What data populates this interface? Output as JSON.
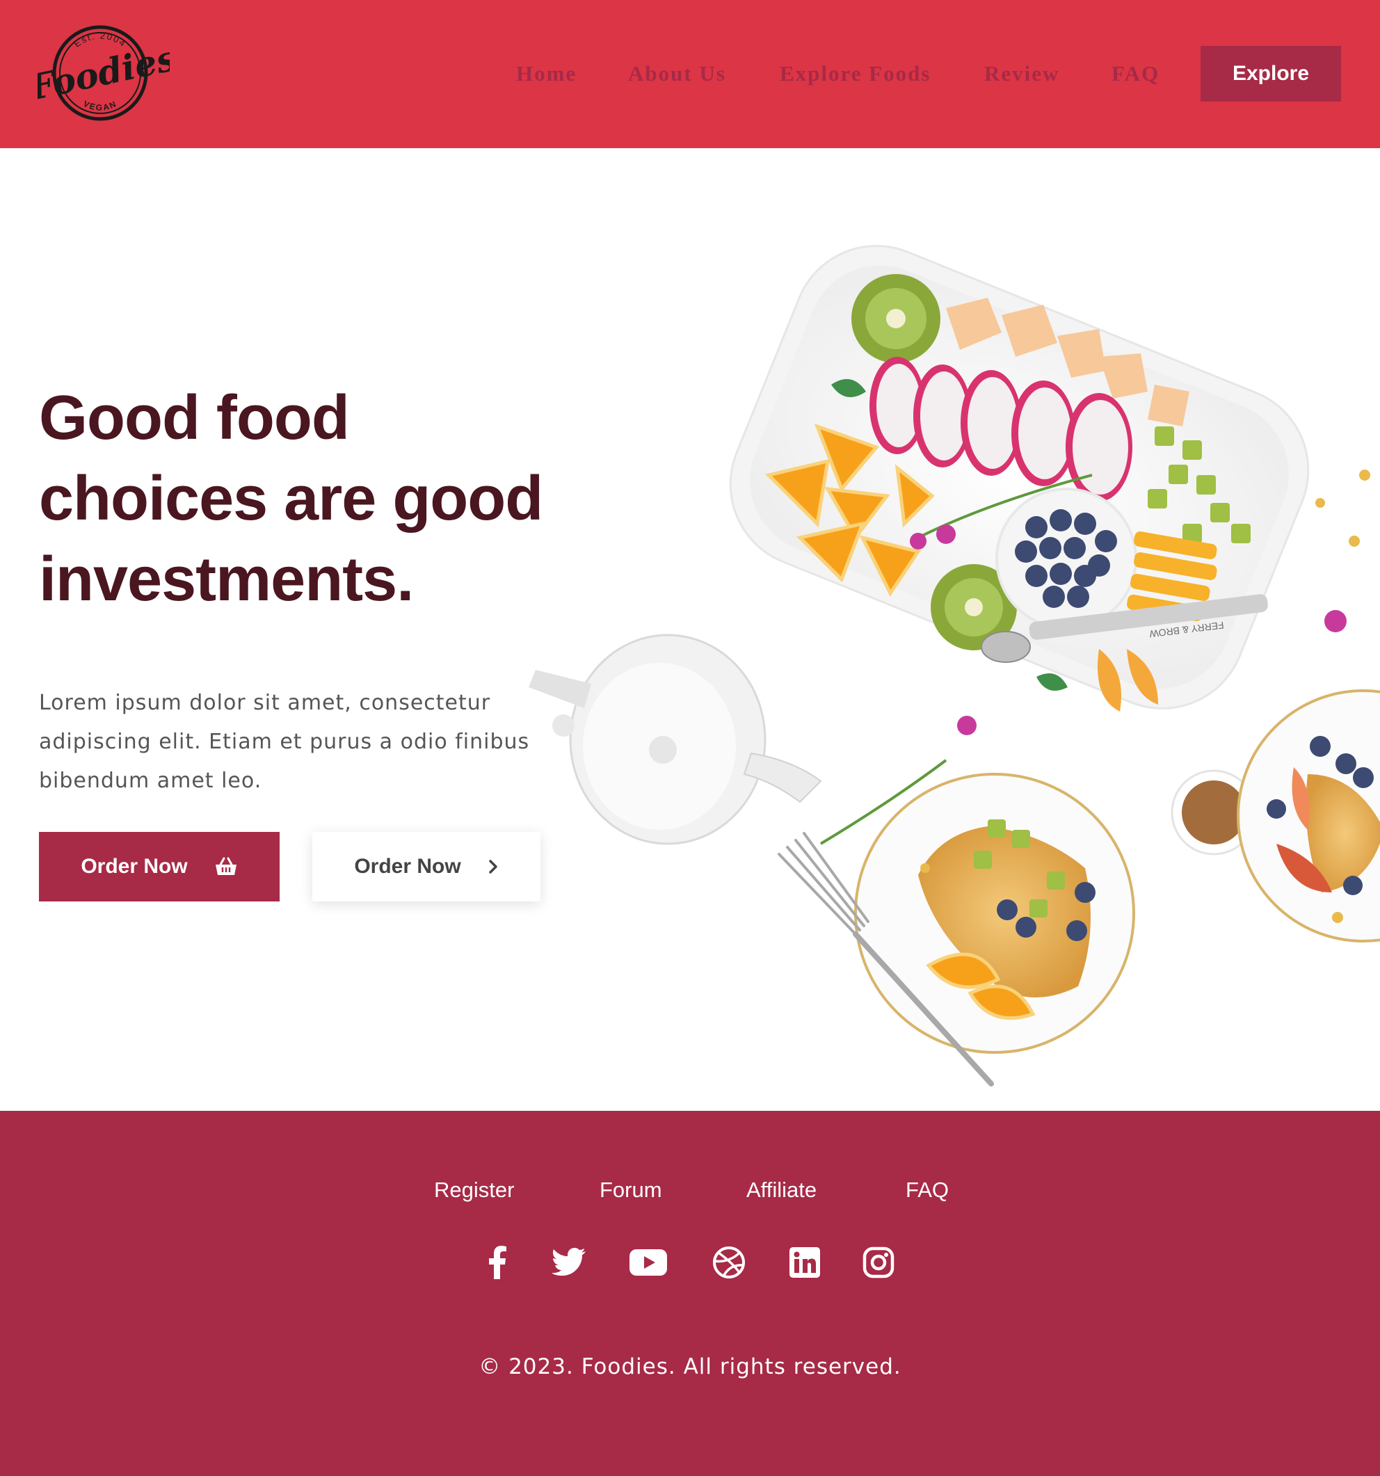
{
  "brand": {
    "name": "Foodies",
    "est": "Est. 2004",
    "tag": "VEGAN"
  },
  "nav": {
    "items": [
      "Home",
      "About Us",
      "Explore Foods",
      "Review",
      "FAQ"
    ],
    "cta": "Explore"
  },
  "hero": {
    "headline_lines": [
      "Good food",
      "choices are good",
      "investments."
    ],
    "subtext": "Lorem ipsum dolor sit amet, consectetur adipiscing elit. Etiam et purus a odio finibus bibendum amet leo.",
    "primary_button": "Order Now",
    "secondary_button": "Order Now",
    "spoon_engraving": "FERRY & BROW"
  },
  "footer": {
    "links": [
      "Register",
      "Forum",
      "Affiliate",
      "FAQ"
    ],
    "social": [
      "facebook-icon",
      "twitter-icon",
      "youtube-icon",
      "dribbble-icon",
      "linkedin-icon",
      "instagram-icon"
    ],
    "copyright": "© 2023. Foodies. All rights reserved."
  },
  "colors": {
    "header_bg": "#dc3545",
    "accent": "#a72a47",
    "headline": "#4a1620",
    "footer_bg": "#a72a47"
  }
}
